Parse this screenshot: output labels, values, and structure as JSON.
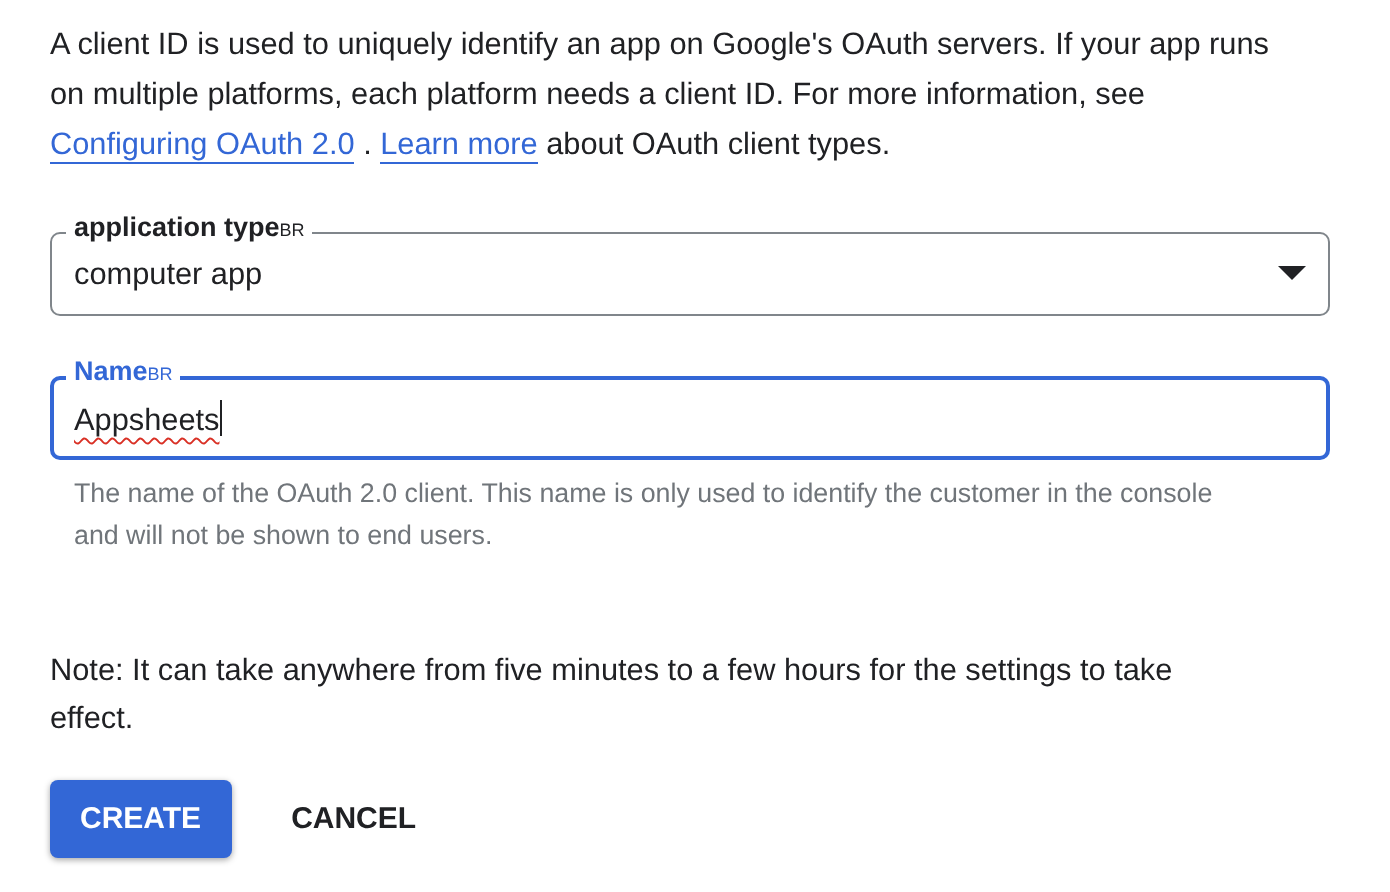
{
  "intro": {
    "text": "A client ID is used to uniquely identify an app on Google's OAuth servers. If your app runs on multiple platforms, each platform needs a client ID. For more information, see",
    "links": [
      "Configuring OAuth 2.0",
      "Learn more"
    ],
    "separator": ".",
    "tail": "about OAuth client types."
  },
  "fields": [
    {
      "kind": "select",
      "label": "application type",
      "label_suffix": "BR",
      "value": "computer app",
      "focused": false
    },
    {
      "kind": "text",
      "label": "Name",
      "label_suffix": "BR",
      "value": "Appsheets",
      "focused": true,
      "spellcheck_error": true,
      "helper": "The name of the OAuth 2.0 client. This name is only used to identify the customer in the console and will not be shown to end users."
    }
  ],
  "note": "Note: It can take anywhere from five minutes to a few hours for the settings to take effect.",
  "buttons": [
    {
      "label": "CREATE",
      "kind": "primary"
    },
    {
      "label": "CANCEL",
      "kind": "text"
    }
  ]
}
